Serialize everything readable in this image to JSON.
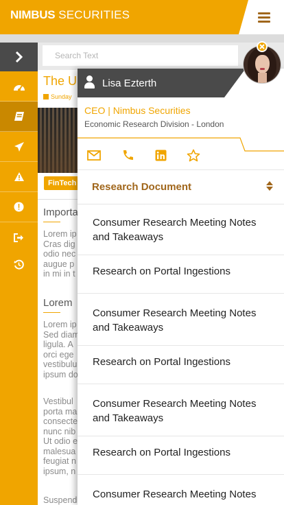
{
  "header": {
    "brand_bold": "NIMBUS",
    "brand_rest": "SECURITIES"
  },
  "search": {
    "placeholder": "Search Text"
  },
  "sidebar": {
    "items": [
      {
        "icon": "dashboard-icon"
      },
      {
        "icon": "book-icon",
        "active": true
      },
      {
        "icon": "airplane-icon"
      },
      {
        "icon": "warning-icon"
      },
      {
        "icon": "alert-circle-icon"
      },
      {
        "icon": "sign-out-icon"
      },
      {
        "icon": "history-icon"
      }
    ]
  },
  "article": {
    "title": "The U",
    "date": "Sunday",
    "tag": "FinTech",
    "heading1": "Importa",
    "para1": [
      "Lorem ip",
      "Cras dig",
      "odio nec",
      "augue p",
      "in mi in t"
    ],
    "heading2": "Lorem",
    "para2": [
      "Lorem ip",
      "Sed diam",
      "ligula. A",
      "orci ege",
      "vestibulu",
      "ipsum do"
    ],
    "para3": [
      "Vestibul",
      "porta ma",
      "consecte",
      "nunc nib",
      "Ut odio e",
      "malesua",
      "feugiat n",
      "ipsum, n"
    ],
    "para4": [
      "Suspend"
    ]
  },
  "profile": {
    "name": "Lisa Ezterth",
    "role": "CEO | Nimbus Securities",
    "division": "Economic Research Division - London",
    "contacts": [
      "email-icon",
      "phone-icon",
      "linkedin-icon",
      "star-icon"
    ]
  },
  "documents": {
    "selector_label": "Research Document",
    "items": [
      "Consumer Research Meeting Notes and Takeaways",
      "Research on Portal Ingestions",
      "Consumer Research Meeting Notes and Takeaways",
      "Research on Portal Ingestions",
      "Consumer Research Meeting Notes and Takeaways",
      "Research on Portal Ingestions",
      "Consumer Research Meeting Notes"
    ]
  },
  "colors": {
    "accent": "#f0a500",
    "accent_dark": "#a0661b",
    "dark_bar": "#4a4a4a"
  }
}
